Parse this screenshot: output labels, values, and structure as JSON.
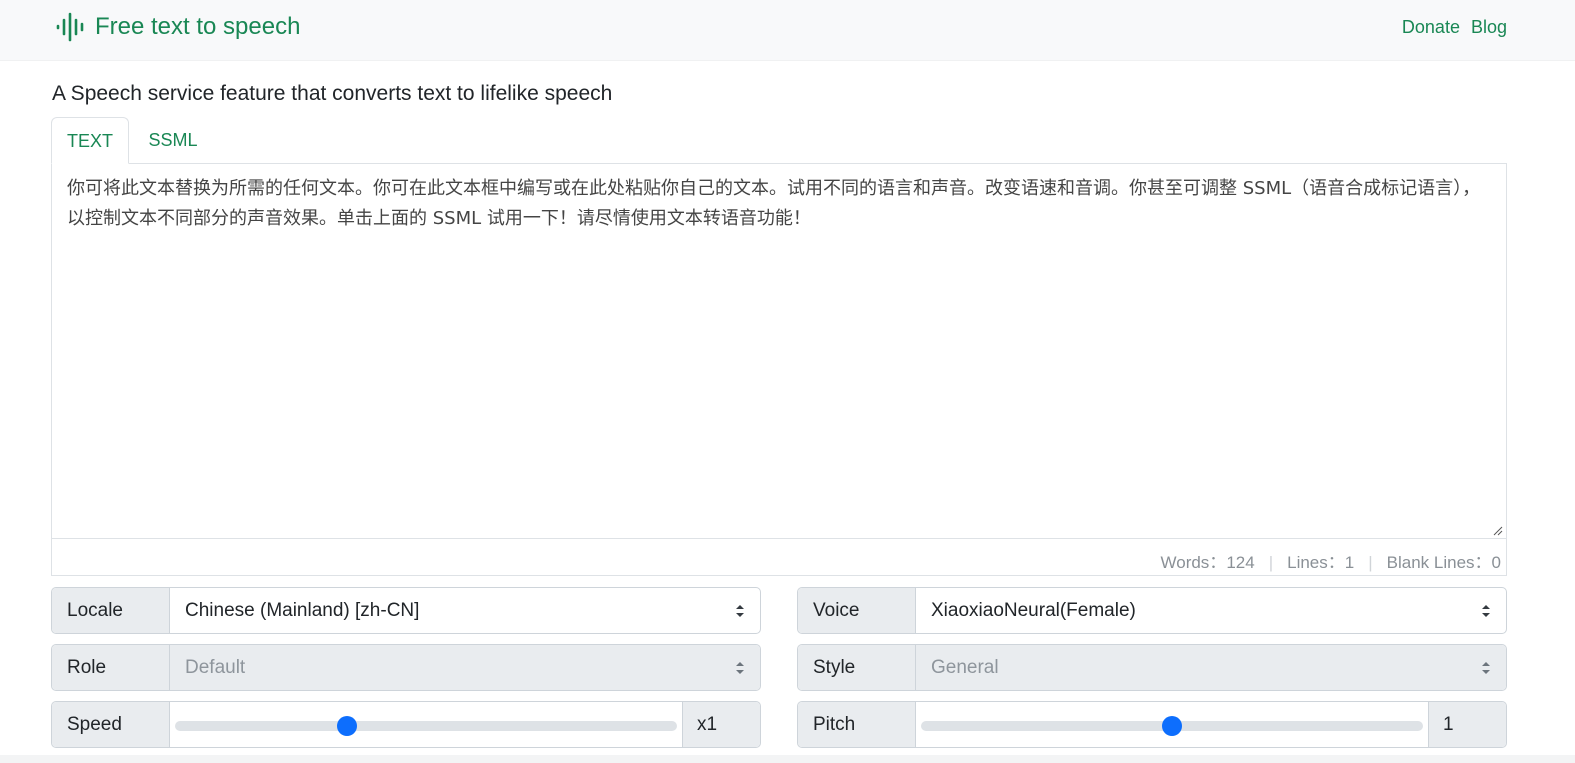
{
  "navbar": {
    "brand": "Free text to speech",
    "links": [
      "Donate",
      "Blog"
    ],
    "brand_icon": "sound-wave-icon"
  },
  "headline": "A Speech service feature that converts text to lifelike speech",
  "tabs": [
    {
      "label": "TEXT",
      "active": true
    },
    {
      "label": "SSML",
      "active": false
    }
  ],
  "editor": {
    "text": "你可将此文本替换为所需的任何文本。你可在此文本框中编写或在此处粘贴你自己的文本。试用不同的语言和声音。改变语速和音调。你甚至可调整 SSML（语音合成标记语言），以控制文本不同部分的声音效果。单击上面的 SSML 试用一下！请尽情使用文本转语音功能！",
    "stats": {
      "words_label": "Words：",
      "words": "124",
      "lines_label": "Lines：",
      "lines": "1",
      "blank_label": "Blank Lines：",
      "blank": "0"
    }
  },
  "controls": {
    "locale": {
      "label": "Locale",
      "value": "Chinese (Mainland) [zh-CN]"
    },
    "voice": {
      "label": "Voice",
      "value": "XiaoxiaoNeural(Female)"
    },
    "role": {
      "label": "Role",
      "value": "Default",
      "disabled": true
    },
    "style": {
      "label": "Style",
      "value": "General",
      "disabled": true
    },
    "speed": {
      "label": "Speed",
      "display": "x1",
      "fraction": 0.34
    },
    "pitch": {
      "label": "Pitch",
      "display": "1",
      "fraction": 0.5
    }
  },
  "colors": {
    "brand": "#198754",
    "slider": "#0d6efd"
  }
}
